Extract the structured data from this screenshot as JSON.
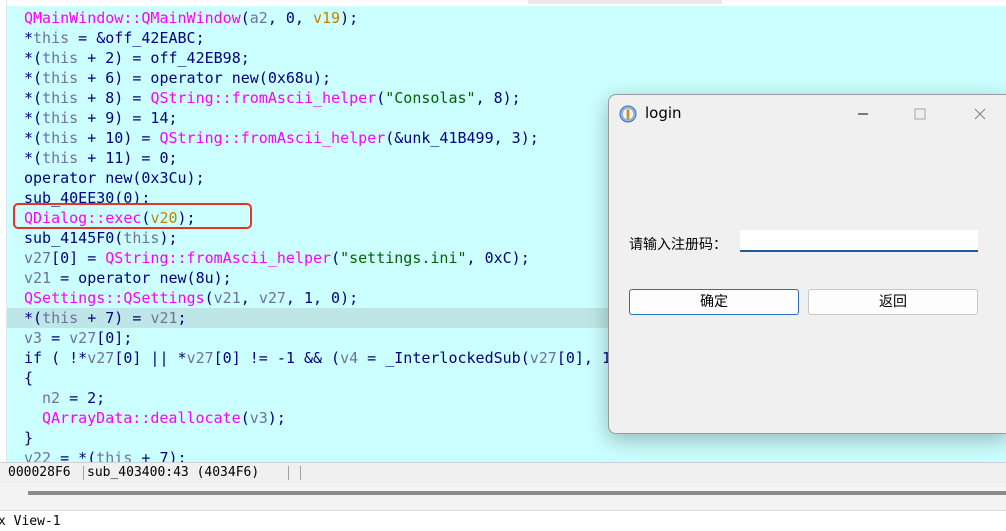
{
  "code_lines": [
    "QMainWindow::QMainWindow(a2, 0, v19);",
    "*this = &off_42EABC;",
    "*(this + 2) = off_42EB98;",
    "*(this + 6) = operator new(0x68u);",
    "*(this + 8) = QString::fromAscii_helper(\"Consolas\", 8);",
    "*(this + 9) = 14;",
    "*(this + 10) = QString::fromAscii_helper(&unk_41B499, 3);",
    "*(this + 11) = 0;",
    "operator new(0x3Cu);",
    "sub_40EE30(0);",
    "QDialog::exec(v20);",
    "sub_4145F0(this);",
    "v27[0] = QString::fromAscii_helper(\"settings.ini\", 0xC);",
    "v21 = operator new(8u);",
    "QSettings::QSettings(v21, v27, 1, 0);",
    "*(this + 7) = v21;",
    "v3 = v27[0];",
    "if ( !*v27[0] || *v27[0] != -1 && (v4 = _InterlockedSub(v27[0], 1",
    "{",
    "n2 = 2;",
    "QArrayData::deallocate(v3);",
    "}",
    "v22 = *(this + 7);"
  ],
  "status": {
    "address": "000028F6",
    "location": "sub_403400:43 (4034F6)"
  },
  "bottom_label": "x View-1",
  "dialog": {
    "title": "login",
    "reg_label": "请输入注册码：",
    "reg_value": "",
    "ok_label": "确定",
    "back_label": "返回"
  },
  "colors": {
    "code_bg": "#ccffff",
    "highlight_row": "#bfe6e6",
    "annotation_box": "#e8322b",
    "accent": "#2a6fc1"
  }
}
